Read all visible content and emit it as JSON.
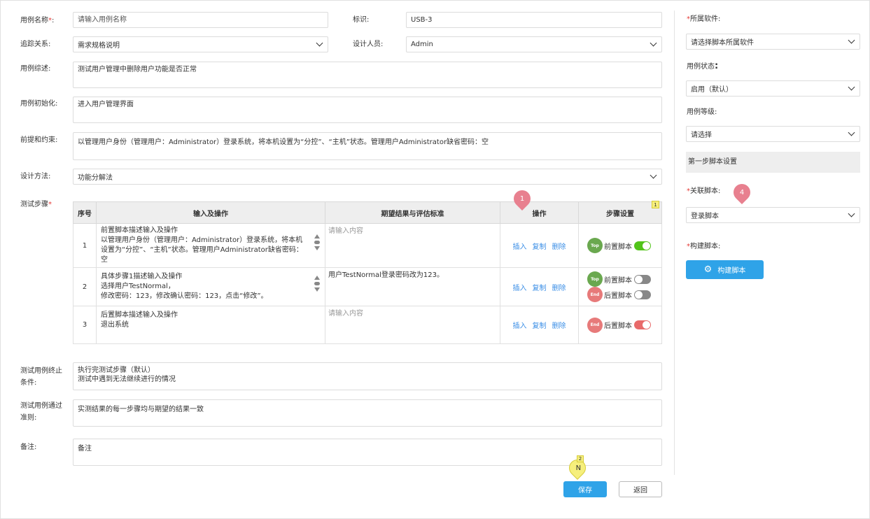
{
  "form": {
    "case_name": {
      "label": "用例名称",
      "placeholder": "请输入用例名称"
    },
    "identifier": {
      "label": "标识:",
      "value": "USB-3"
    },
    "trace": {
      "label": "追踪关系:",
      "value": "需求规格说明"
    },
    "designer": {
      "label": "设计人员:",
      "value": "Admin"
    },
    "summary": {
      "label": "用例综述:",
      "value": "测试用户管理中删除用户功能是否正常"
    },
    "init": {
      "label": "用例初始化:",
      "value": "进入用户管理界面"
    },
    "precondition": {
      "label": "前提和约束:",
      "value": "以管理用户身份（管理用户：Administrator）登录系统，将本机设置为“分控”、“主机”状态。管理用户Administrator缺省密码：空"
    },
    "method": {
      "label": "设计方法:",
      "value": "功能分解法"
    },
    "steps_label": "测试步骤",
    "end_condition": {
      "label_line1": "测试用例终止",
      "label_line2": "条件:",
      "line1": "执行完测试步骤（默认）",
      "line2": "测试中遇到无法继续进行的情况"
    },
    "pass_criteria": {
      "label_line1": "测试用例通过",
      "label_line2": "准则:",
      "value": "实测结果的每一步骤均与期望的结果一致"
    },
    "remarks": {
      "label": "备注:",
      "value": "备注"
    }
  },
  "table": {
    "headers": [
      "序号",
      "输入及操作",
      "期望结果与评估标准",
      "操作",
      "步骤设置"
    ],
    "op_labels": {
      "insert": "插入",
      "copy": "复制",
      "delete": "删除"
    },
    "rows": [
      {
        "num": "1",
        "io": [
          "前置脚本描述输入及操作",
          "以管理用户身份（管理用户：Administrator）登录系统，将本机设置为“分控”、“主机”状态。管理用户Administrator缺省密码：空"
        ],
        "expect": "请输入内容",
        "expect_placeholder": true,
        "steps": [
          {
            "badge": "Top",
            "label": "前置脚本",
            "state": "on"
          }
        ]
      },
      {
        "num": "2",
        "io": [
          "具体步骤1描述输入及操作",
          "选择用户TestNormal，",
          "修改密码：123，修改确认密码：123，点击“修改”。"
        ],
        "expect": "用户TestNormal登录密码改为123。",
        "expect_placeholder": false,
        "steps": [
          {
            "badge": "Top",
            "label": "前置脚本",
            "state": "off"
          },
          {
            "badge": "End",
            "label": "后置脚本",
            "state": "off"
          }
        ]
      },
      {
        "num": "3",
        "io": [
          "后置脚本描述输入及操作",
          "退出系统"
        ],
        "expect": "请输入内容",
        "expect_placeholder": true,
        "steps": [
          {
            "badge": "End",
            "label": "后置脚本",
            "state": "on"
          }
        ]
      }
    ]
  },
  "sidebar": {
    "software": {
      "label": "所属软件:",
      "value": "请选择脚本所属软件"
    },
    "status": {
      "label": "用例状态",
      "colon": ":",
      "value": "启用（默认）"
    },
    "level": {
      "label": "用例等级:",
      "value": "请选择"
    },
    "section_title": "第一步脚本设置",
    "linked_script": {
      "label": "关联脚本:",
      "value": "登录脚本"
    },
    "build_script": {
      "label": "构建脚本:",
      "button": "构建脚本"
    }
  },
  "buttons": {
    "save": "保存",
    "back": "返回"
  },
  "markers": {
    "m1": "1",
    "m2": "2",
    "m2_text": "N",
    "m4": "4",
    "note1": "1"
  },
  "colors": {
    "primary": "#2fa3e8",
    "link": "#3a8ee6",
    "required": "#e53935",
    "marker_pink": "#e8808f",
    "marker_yellow": "#f6ef7c",
    "toggle_green": "#52c41a",
    "toggle_red": "#e86a6a"
  }
}
